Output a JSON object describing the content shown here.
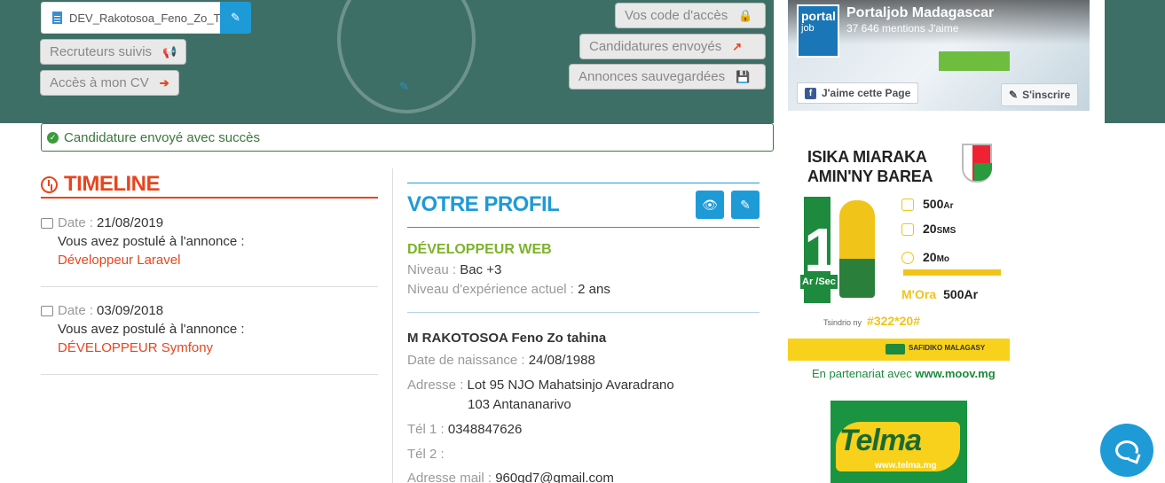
{
  "header": {
    "cv_filename": "DEV_Rakotosoa_Feno_Zo_T",
    "buttons": {
      "recruteurs": "Recruteurs suivis",
      "acces_cv": "Accès à mon CV",
      "codes": "Vos code d'accès",
      "candidatures": "Candidatures envoyés",
      "annonces": "Annonces sauvegardées"
    }
  },
  "facebook": {
    "page_name": "Portaljob Madagascar",
    "likes": "37 646 mentions J'aime",
    "like_button": "J'aime cette Page",
    "subscribe_button": "S'inscrire"
  },
  "alert": {
    "message": "Candidature envoyé avec succès"
  },
  "timeline": {
    "title": "TIMELINE",
    "entries": [
      {
        "date_label": "Date :",
        "date": "21/08/2019",
        "text": "Vous avez postulé à l'annonce :",
        "job": "Développeur Laravel"
      },
      {
        "date_label": "Date :",
        "date": "03/09/2018",
        "text": "Vous avez postulé à l'annonce :",
        "job": "DÉVELOPPEUR Symfony"
      }
    ]
  },
  "profile": {
    "title": "VOTRE PROFIL",
    "job_title": "DÉVELOPPEUR WEB",
    "niveau_label": "Niveau :",
    "niveau": "Bac +3",
    "experience_label": "Niveau d'expérience actuel :",
    "experience": "2 ans",
    "name": "M RAKOTOSOA Feno Zo tahina",
    "birth_label": "Date de naissance :",
    "birth": "24/08/1988",
    "address_label": "Adresse :",
    "address_line1": "Lot 95 NJO Mahatsinjo Avaradrano",
    "address_line2": "103 Antananarivo",
    "tel1_label": "Tél 1 :",
    "tel1": "0348847626",
    "tel2_label": "Tél 2 :",
    "tel2": "",
    "email_label": "Adresse mail :",
    "email": "960gd7@gmail.com"
  },
  "ads": {
    "moov_title_line1": "ISIKA MIARAKA",
    "moov_title_line2": "AMIN'NY BAREA",
    "big_one": "1",
    "ar_sec": "Ar /Sec",
    "offer1": "500",
    "offer1_unit": "Ar",
    "offer2": "20",
    "offer2_unit": "SMS",
    "offer3": "20",
    "offer3_unit": "Mo",
    "mora": "M'Ora",
    "mora_price": "500Ar",
    "code_label": "Tsindrio ny",
    "code": "#322*20#",
    "footer_brand": "SAFIDIKO MALAGASY",
    "partner_text": "En partenariat avec",
    "partner_url": "www.moov.mg",
    "telma_word": "Telma",
    "telma_url": "www.telma.mg"
  }
}
